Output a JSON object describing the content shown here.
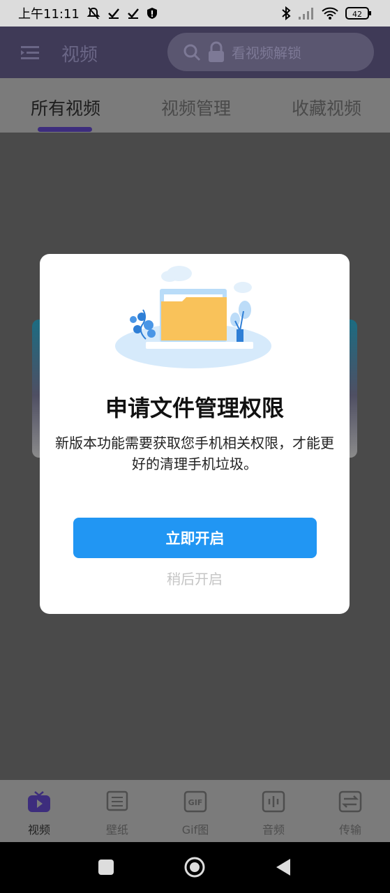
{
  "status_bar": {
    "time": "上午11:11",
    "battery": "42"
  },
  "top_bar": {
    "title": "视频",
    "unlock_label": "看视频解锁"
  },
  "tabs": [
    {
      "label": "所有视频"
    },
    {
      "label": "视频管理"
    },
    {
      "label": "收藏视频"
    }
  ],
  "dialog": {
    "title": "申请文件管理权限",
    "message": "新版本功能需要获取您手机相关权限，才能更好的清理手机垃圾。",
    "primary_button": "立即开启",
    "secondary_button": "稍后开启"
  },
  "bottom_nav": [
    {
      "label": "视频",
      "icon": "video-icon"
    },
    {
      "label": "壁纸",
      "icon": "wallpaper-icon"
    },
    {
      "label": "Gif图",
      "icon": "gif-icon"
    },
    {
      "label": "音频",
      "icon": "audio-icon"
    },
    {
      "label": "传输",
      "icon": "transfer-icon"
    }
  ],
  "colors": {
    "accent": "#2196f3",
    "brand": "#3d2d7d",
    "overlay": "#4a4a4a"
  }
}
